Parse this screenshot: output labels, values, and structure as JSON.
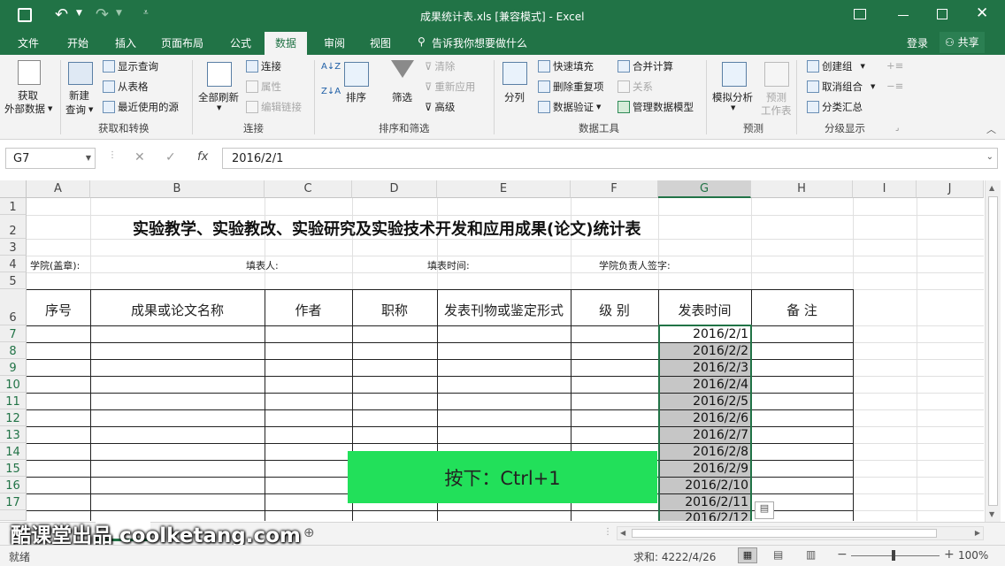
{
  "window": {
    "title": "成果统计表.xls  [兼容模式] - Excel",
    "qat": {
      "save_icon": "save-icon",
      "undo_icon": "undo-icon",
      "redo_icon": "redo-icon",
      "customize_icon": "customize-icon"
    },
    "controls": {
      "ribbon_display": "ribbon-display-icon",
      "minimize": "minimize-icon",
      "maximize": "maximize-icon",
      "close": "close-icon"
    }
  },
  "tabs": [
    "文件",
    "开始",
    "插入",
    "页面布局",
    "公式",
    "数据",
    "审阅",
    "视图"
  ],
  "active_tab": "数据",
  "tell_me": "告诉我你想要做什么",
  "login": "登录",
  "share": "共享",
  "ribbon": {
    "get_external": "获取",
    "get_external2": "外部数据",
    "new_query": "新建",
    "new_query2": "查询",
    "show_queries": "显示查询",
    "from_table": "从表格",
    "recent_sources": "最近使用的源",
    "refresh_all": "全部刷新",
    "connections": "连接",
    "properties": "属性",
    "edit_links": "编辑链接",
    "sort_az": "A↓Z",
    "sort_za": "Z↓A",
    "sort": "排序",
    "filter": "筛选",
    "clear": "清除",
    "reapply": "重新应用",
    "advanced": "高级",
    "split": "分列",
    "flash_fill": "快速填充",
    "remove_dup": "删除重复项",
    "data_validation": "数据验证",
    "consolidate": "合并计算",
    "relationships": "关系",
    "manage_model": "管理数据模型",
    "what_if": "模拟分析",
    "forecast_sheet": "预测",
    "forecast_sheet2": "工作表",
    "group": "创建组",
    "ungroup": "取消组合",
    "subtotal": "分类汇总",
    "groups": [
      "获取和转换",
      "连接",
      "排序和筛选",
      "数据工具",
      "预测",
      "分级显示"
    ]
  },
  "formula_bar": {
    "name_box": "G7",
    "cancel": "✕",
    "enter": "✓",
    "fx": "fx",
    "value": "2016/2/1"
  },
  "columns": [
    "A",
    "B",
    "C",
    "D",
    "E",
    "F",
    "G",
    "H",
    "I",
    "J"
  ],
  "rows": [
    "1",
    "2",
    "3",
    "4",
    "5",
    "6",
    "7",
    "8",
    "9",
    "10",
    "11",
    "12",
    "13",
    "14",
    "15",
    "16",
    "17"
  ],
  "sheet": {
    "title": "实验教学、实验教改、实验研究及实验技术开发和应用成果(论文)统计表",
    "row4": [
      "学院(盖章):",
      "填表人:",
      "填表时间:",
      "学院负责人签字:"
    ],
    "headers": [
      "序号",
      "成果或论文名称",
      "作者",
      "职称",
      "发表刊物或鉴定形式",
      "级 别",
      "发表时间",
      "备 注"
    ],
    "dates": [
      "2016/2/1",
      "2016/2/2",
      "2016/2/3",
      "2016/2/4",
      "2016/2/5",
      "2016/2/6",
      "2016/2/7",
      "2016/2/8",
      "2016/2/9",
      "2016/2/10",
      "2016/2/11",
      "2016/2/12"
    ]
  },
  "overlay": {
    "text": "按下：Ctrl+1",
    "color": "#22e05a"
  },
  "watermark": "酷课堂出品 coolketang.com",
  "status": {
    "ready": "就绪",
    "sum": "求和: 4222/4/26",
    "zoom": "100%",
    "zoom_minus": "−",
    "zoom_plus": "+"
  },
  "colors": {
    "accent": "#217346",
    "selection": "#217346",
    "selected_fill": "#c6c6c6"
  }
}
